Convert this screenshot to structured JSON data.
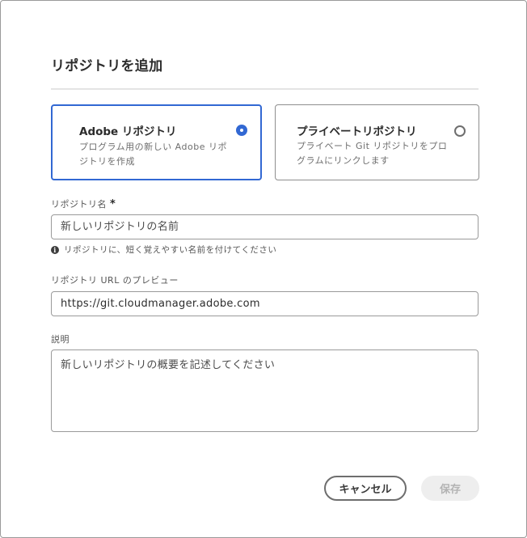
{
  "dialog": {
    "title": "リポジトリを追加"
  },
  "repo_types": [
    {
      "title": "Adobe リポジトリ",
      "description": "プログラム用の新しい Adobe リポジトリを作成",
      "selected": true
    },
    {
      "title": "プライベートリポジトリ",
      "description": "プライベート Git リポジトリをプログラムにリンクします",
      "selected": false
    }
  ],
  "repo_name": {
    "label": "リポジトリ名",
    "required_mark": "*",
    "placeholder": "新しいリポジトリの名前",
    "value": "",
    "helper_icon": "info-icon",
    "helper_text": "リポジトリに、短く覚えやすい名前を付けてください"
  },
  "repo_url": {
    "label": "リポジトリ URL のプレビュー",
    "value": "https://git.cloudmanager.adobe.com"
  },
  "description": {
    "label": "説明",
    "placeholder": "新しいリポジトリの概要を記述してください",
    "value": ""
  },
  "actions": {
    "cancel_label": "キャンセル",
    "save_label": "保存",
    "save_enabled": false
  },
  "colors": {
    "accent": "#3268d3",
    "border": "#9a9a9a",
    "disabled_bg": "#eeeeee",
    "disabled_text": "#b3b3b3"
  }
}
